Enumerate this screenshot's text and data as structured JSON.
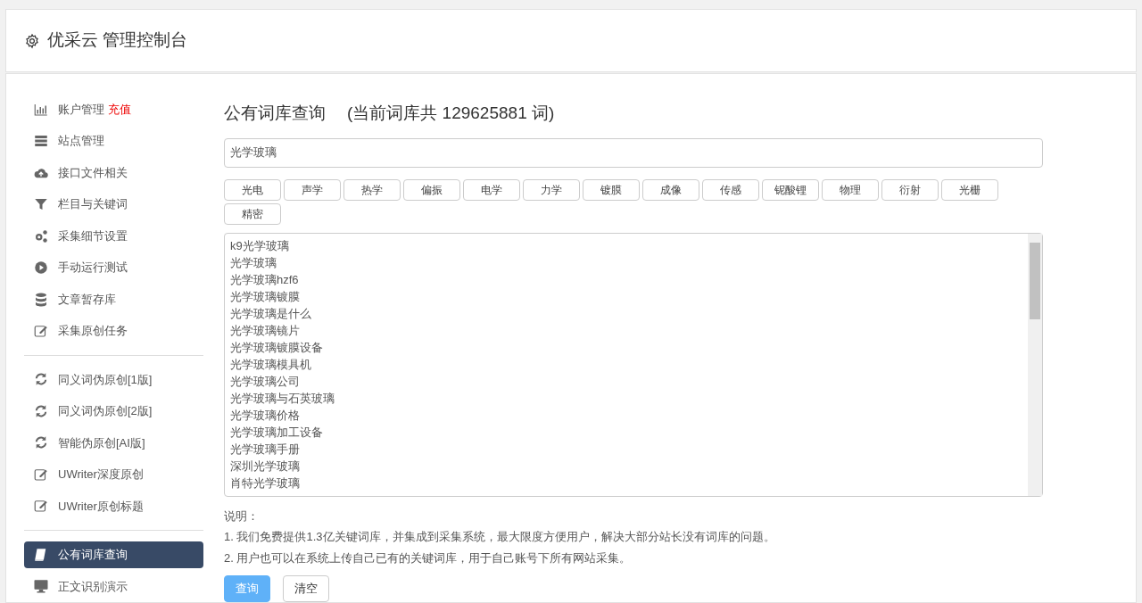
{
  "header": {
    "title": "优采云 管理控制台"
  },
  "sidebar": {
    "items": [
      {
        "kind": "item",
        "label": "账户管理",
        "badge": "充值",
        "selected": false
      },
      {
        "kind": "item",
        "label": "站点管理",
        "selected": false
      },
      {
        "kind": "item",
        "label": "接口文件相关",
        "selected": false
      },
      {
        "kind": "item",
        "label": "栏目与关键词",
        "selected": false
      },
      {
        "kind": "item",
        "label": "采集细节设置",
        "selected": false
      },
      {
        "kind": "item",
        "label": "手动运行测试",
        "selected": false
      },
      {
        "kind": "item",
        "label": "文章暂存库",
        "selected": false
      },
      {
        "kind": "item",
        "label": "采集原创任务",
        "selected": false
      },
      {
        "kind": "divider"
      },
      {
        "kind": "item",
        "label": "同义词伪原创[1版]",
        "selected": false
      },
      {
        "kind": "item",
        "label": "同义词伪原创[2版]",
        "selected": false
      },
      {
        "kind": "item",
        "label": "智能伪原创[AI版]",
        "selected": false
      },
      {
        "kind": "item",
        "label": "UWriter深度原创",
        "selected": false
      },
      {
        "kind": "item",
        "label": "UWriter原创标题",
        "selected": false
      },
      {
        "kind": "divider"
      },
      {
        "kind": "item",
        "label": "公有词库查询",
        "selected": true
      },
      {
        "kind": "item",
        "label": "正文识别演示",
        "selected": false
      }
    ]
  },
  "main": {
    "title": "公有词库查询",
    "subtitle": "(当前词库共 129625881 词)",
    "search": {
      "value": "光学玻璃"
    },
    "tags": [
      "光电",
      "声学",
      "热学",
      "偏振",
      "电学",
      "力学",
      "镀膜",
      "成像",
      "传感",
      "铌酸锂",
      "物理",
      "衍射",
      "光栅",
      "精密"
    ],
    "results": [
      "k9光学玻璃",
      "光学玻璃",
      "光学玻璃hzf6",
      "光学玻璃镀膜",
      "光学玻璃是什么",
      "光学玻璃镜片",
      "光学玻璃镀膜设备",
      "光学玻璃模具机",
      "光学玻璃公司",
      "光学玻璃与石英玻璃",
      "光学玻璃价格",
      "光学玻璃加工设备",
      "光学玻璃手册",
      "深圳光学玻璃",
      "肖特光学玻璃"
    ],
    "notes_title": "说明：",
    "notes": [
      "1. 我们免费提供1.3亿关键词库，并集成到采集系统，最大限度方便用户，解决大部分站长没有词库的问题。",
      "2. 用户也可以在系统上传自己已有的关键词库，用于自己账号下所有网站采集。"
    ],
    "buttons": [
      {
        "kind": "primary",
        "label": "查询"
      },
      {
        "kind": "default",
        "label": "清空"
      }
    ]
  }
}
